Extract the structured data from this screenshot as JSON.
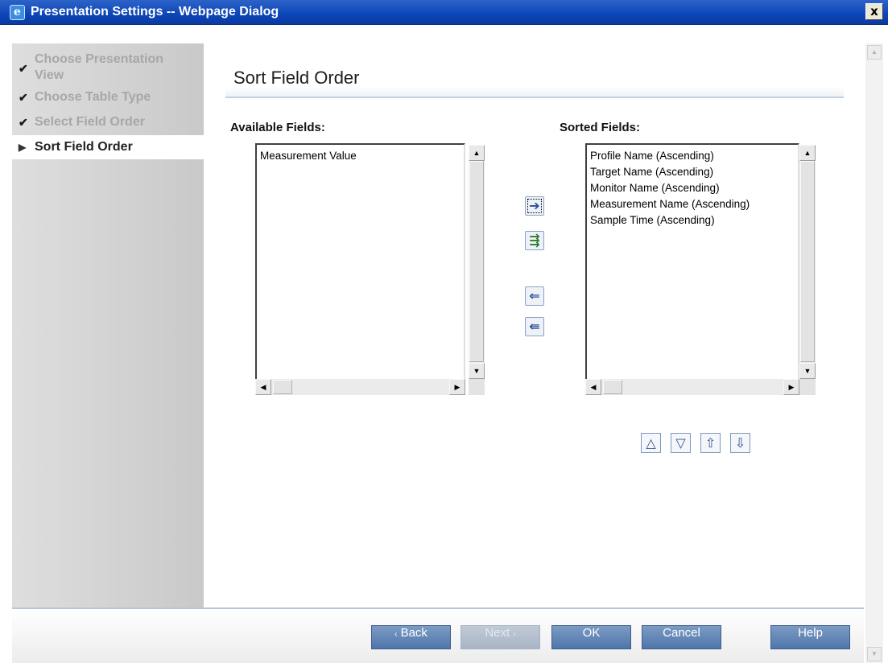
{
  "window": {
    "title": "Presentation Settings -- Webpage Dialog",
    "close_label": "x"
  },
  "wizard": {
    "steps": [
      {
        "label": "Choose Presentation",
        "label2": "View",
        "state": "done"
      },
      {
        "label": "Choose Table Type",
        "state": "done"
      },
      {
        "label": "Select Field Order",
        "state": "done"
      },
      {
        "label": "Sort Field Order",
        "state": "current"
      }
    ]
  },
  "main": {
    "title": "Sort Field Order",
    "available_label": "Available Fields:",
    "available_items": [
      "Measurement Value"
    ],
    "sorted_label": "Sorted Fields:",
    "sorted_items": [
      "Profile Name (Ascending)",
      "Target Name (Ascending)",
      "Monitor Name (Ascending)",
      "Measurement Name (Ascending)",
      "Sample Time (Ascending)"
    ]
  },
  "transfer_buttons": {
    "add": "arrow-right-icon",
    "add_all": "arrow-right-all-icon",
    "remove": "arrow-left-icon",
    "remove_all": "arrow-left-all-icon"
  },
  "order_buttons": {
    "up": "triangle-up-icon",
    "down": "triangle-down-icon",
    "top": "arrow-up-icon",
    "bottom": "arrow-down-icon"
  },
  "footer": {
    "back": "Back",
    "next": "Next",
    "ok": "OK",
    "cancel": "Cancel",
    "help": "Help"
  },
  "colors": {
    "titlebar": "#0c45b8",
    "button": "#4f76aa",
    "sidebar": "#d6d6d6"
  }
}
